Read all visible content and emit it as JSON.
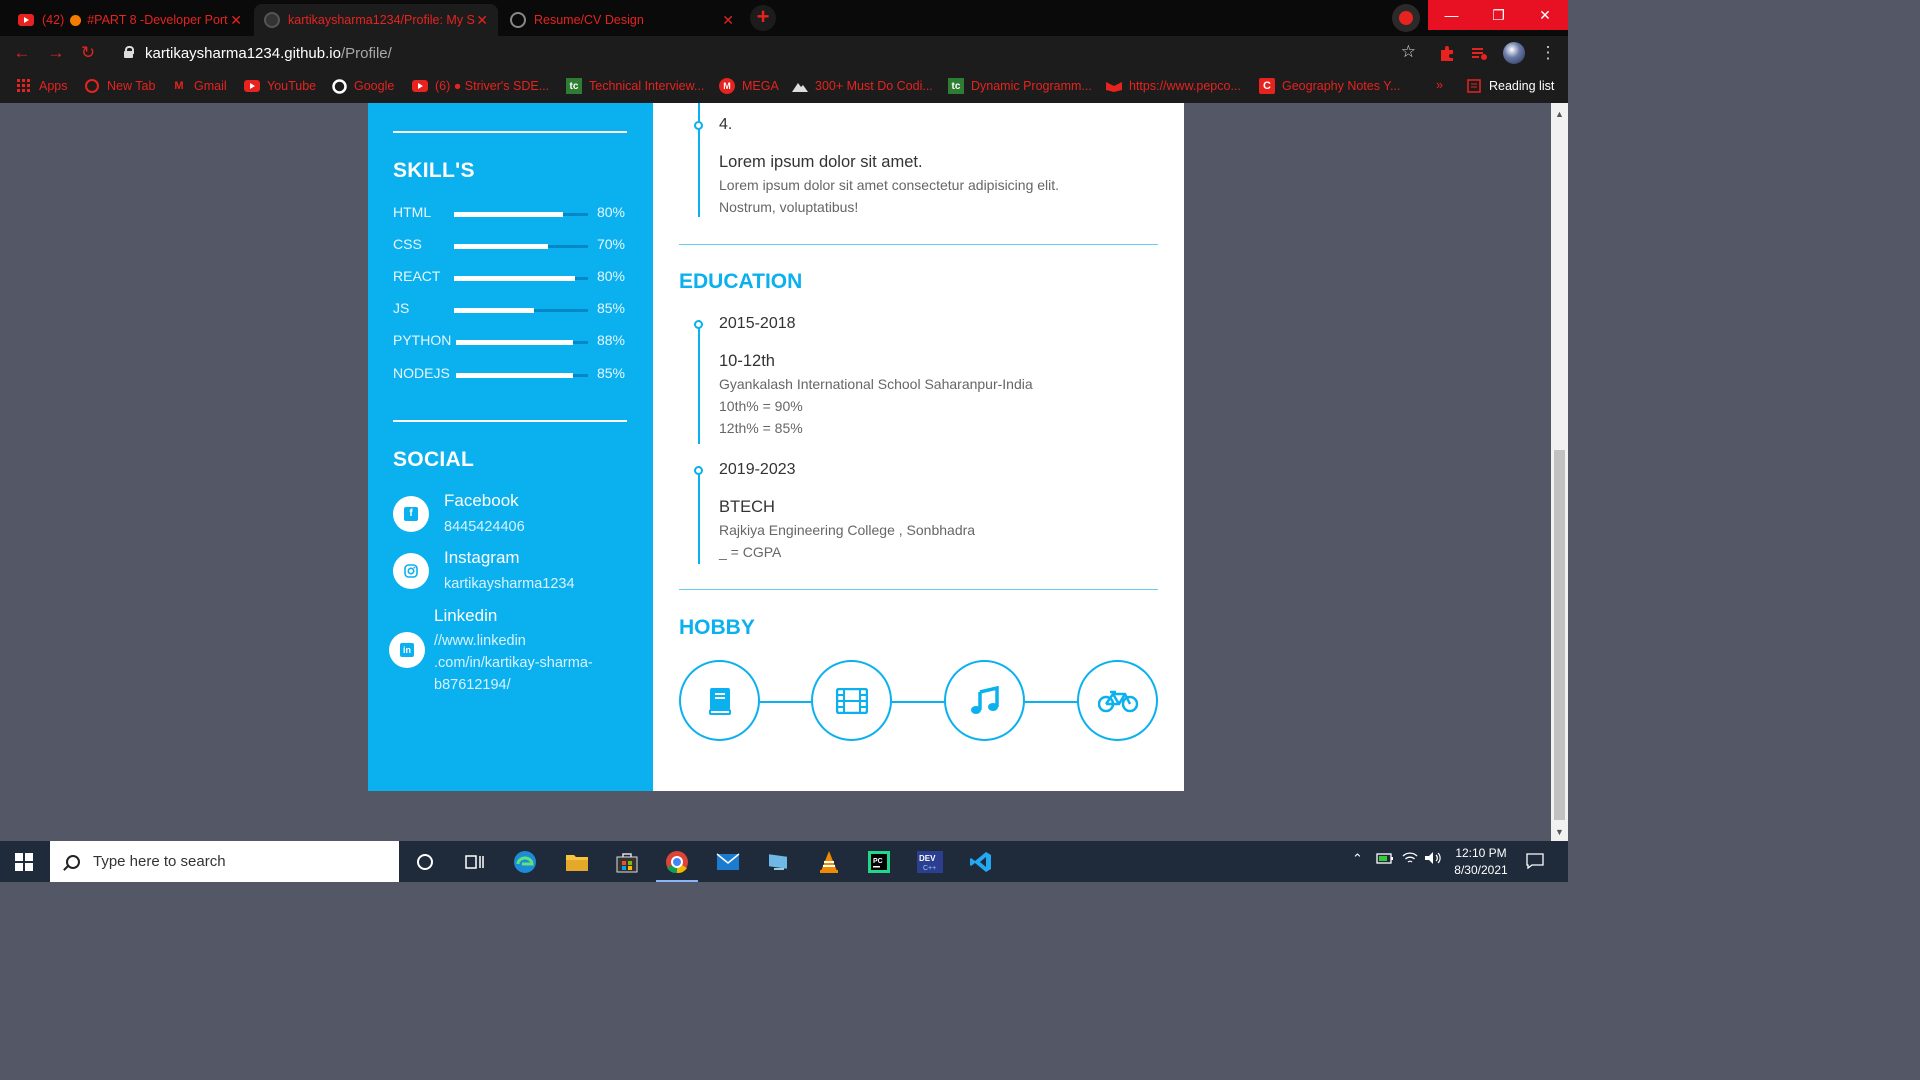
{
  "browser": {
    "tabs": [
      {
        "title": "(42) ● #PART 8 -Developer Port",
        "badge": "(42)",
        "label": "#PART 8 -Developer Port"
      },
      {
        "title": "kartikaysharma1234/Profile: My S"
      },
      {
        "title": "Resume/CV Design"
      }
    ],
    "url": {
      "host": "kartikaysharma1234.github.io",
      "path": "/Profile/"
    },
    "window_controls": {
      "minimize": "—",
      "restore": "❐",
      "close": "✕"
    },
    "bookmarks": [
      {
        "label": "Apps",
        "icon": "apps-grid-icon"
      },
      {
        "label": "New Tab",
        "icon": "newtab-icon"
      },
      {
        "label": "Gmail",
        "icon": "gmail-icon"
      },
      {
        "label": "YouTube",
        "icon": "youtube-icon"
      },
      {
        "label": "Google",
        "icon": "google-icon"
      },
      {
        "label": "(6) ● Striver's SDE...",
        "icon": "youtube-icon"
      },
      {
        "label": "Technical Interview...",
        "icon": "tc-icon"
      },
      {
        "label": "MEGA",
        "icon": "mega-icon"
      },
      {
        "label": "300+ Must Do Codi...",
        "icon": "mountain-icon"
      },
      {
        "label": "Dynamic Programm...",
        "icon": "tc-icon"
      },
      {
        "label": "https://www.pepco...",
        "icon": "pepcoding-icon"
      },
      {
        "label": "Geography Notes Y...",
        "icon": "c-icon"
      }
    ],
    "bookmarks_more": "»",
    "reading_list": "Reading list"
  },
  "resume": {
    "skills": {
      "title": "SKILL'S",
      "items": [
        {
          "name": "HTML",
          "percent_label": "80%",
          "bar_fill": 0.81
        },
        {
          "name": "CSS",
          "percent_label": "70%",
          "bar_fill": 0.7
        },
        {
          "name": "REACT",
          "percent_label": "80%",
          "bar_fill": 0.9
        },
        {
          "name": "JS",
          "percent_label": "85%",
          "bar_fill": 0.6
        },
        {
          "name": "PYTHON",
          "percent_label": "88%",
          "bar_fill": 0.89
        },
        {
          "name": "NODEJS",
          "percent_label": "85%",
          "bar_fill": 0.89
        }
      ]
    },
    "social": {
      "title": "SOCIAL",
      "items": [
        {
          "name": "Facebook",
          "value_lines": [
            "8445424406"
          ],
          "icon": "facebook-icon"
        },
        {
          "name": "Instagram",
          "value_lines": [
            "kartikaysharma1234"
          ],
          "icon": "instagram-icon"
        },
        {
          "name": "Linkedin",
          "value_lines": [
            "//www.linkedin",
            ".com/in/kartikay-sharma-",
            "b87612194/"
          ],
          "icon": "linkedin-icon"
        }
      ]
    },
    "experience_tail": {
      "number": "4.",
      "title": "Lorem ipsum dolor sit amet.",
      "desc_lines": [
        "Lorem ipsum dolor sit amet consectetur adipisicing elit.",
        "Nostrum, voluptatibus!"
      ]
    },
    "education": {
      "title": "EDUCATION",
      "items": [
        {
          "years": "2015-2018",
          "degree": "10-12th",
          "lines": [
            "Gyankalash International School Saharanpur-India",
            "10th% = 90%",
            "12th% = 85%"
          ]
        },
        {
          "years": "2019-2023",
          "degree": "BTECH",
          "lines": [
            "Rajkiya Engineering College , Sonbhadra",
            "_ = CGPA"
          ]
        }
      ]
    },
    "hobby": {
      "title": "HOBBY",
      "items": [
        "book-icon",
        "film-icon",
        "music-icon",
        "bicycle-icon"
      ]
    }
  },
  "taskbar": {
    "search_placeholder": "Type here to search",
    "time": "12:10 PM",
    "date": "8/30/2021"
  },
  "colors": {
    "accent": "#0bb0ef",
    "page_bg": "#535766",
    "chrome_red": "#e6231f"
  }
}
